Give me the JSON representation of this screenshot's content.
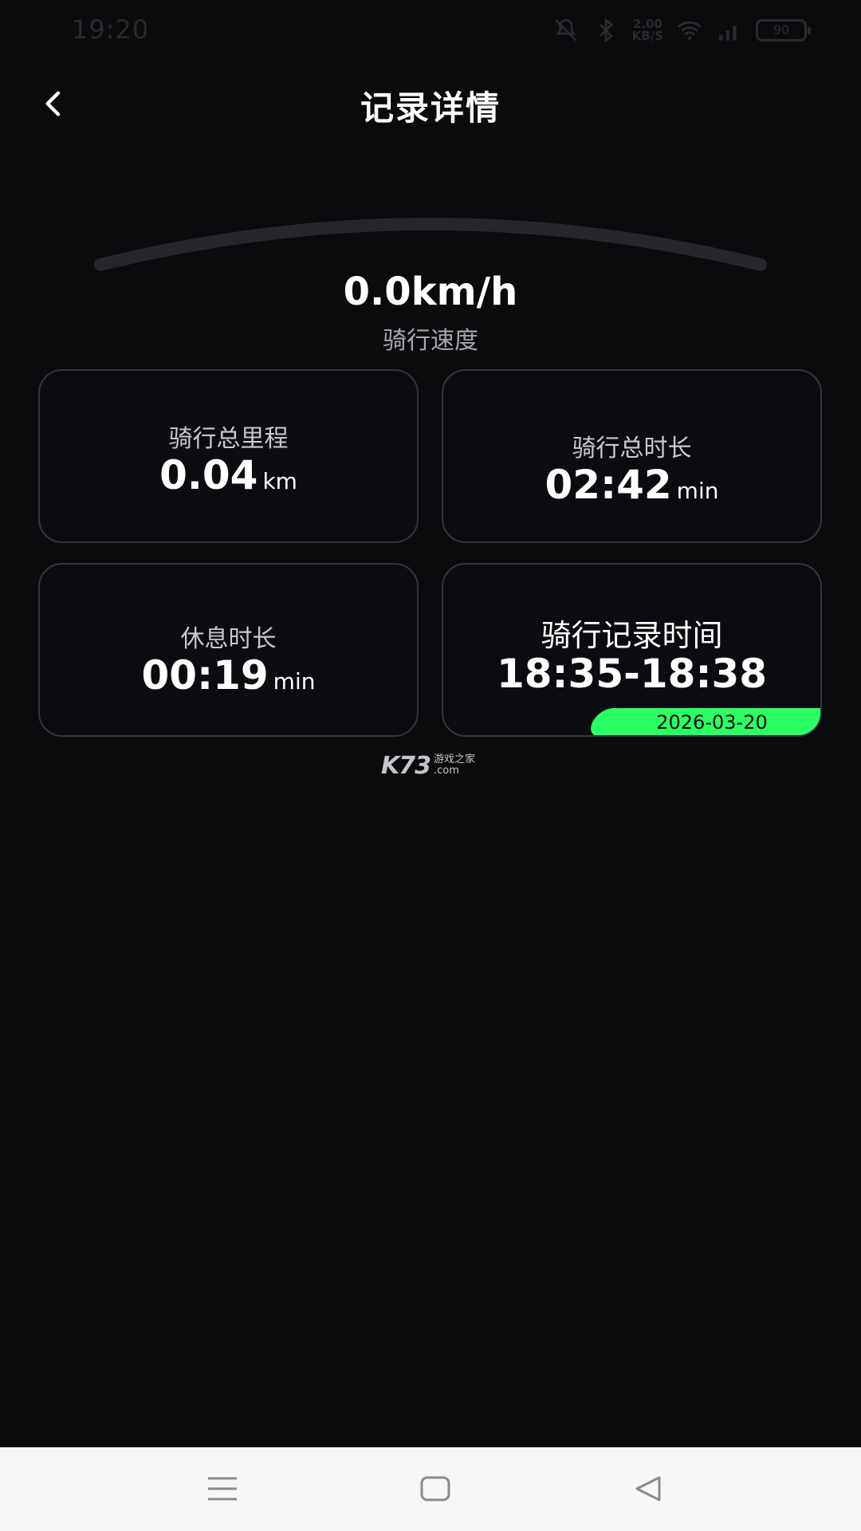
{
  "status_bar": {
    "time": "19:20",
    "net_speed_value": "2.00",
    "net_speed_unit": "KB/S",
    "battery_level": "90"
  },
  "header": {
    "title": "记录详情",
    "back_icon": "chevron-left-icon"
  },
  "speed": {
    "value": "0.0km/h",
    "label": "骑行速度"
  },
  "cards": {
    "distance": {
      "label": "骑行总里程",
      "value": "0.04",
      "unit": "km"
    },
    "duration": {
      "label": "骑行总时长",
      "value": "02:42",
      "unit": "min"
    },
    "rest": {
      "label": "休息时长",
      "value": "00:19",
      "unit": "min"
    },
    "record_time": {
      "label": "骑行记录时间",
      "value": "18:35-18:38",
      "date": "2026-03-20"
    }
  },
  "watermark": {
    "logo": "K73",
    "line1": "游戏之家",
    "line2": ".com"
  },
  "colors": {
    "background": "#0a0b0d",
    "card_border": "#34363b",
    "accent_green": "#2bff63",
    "gauge_track": "#26272c"
  }
}
